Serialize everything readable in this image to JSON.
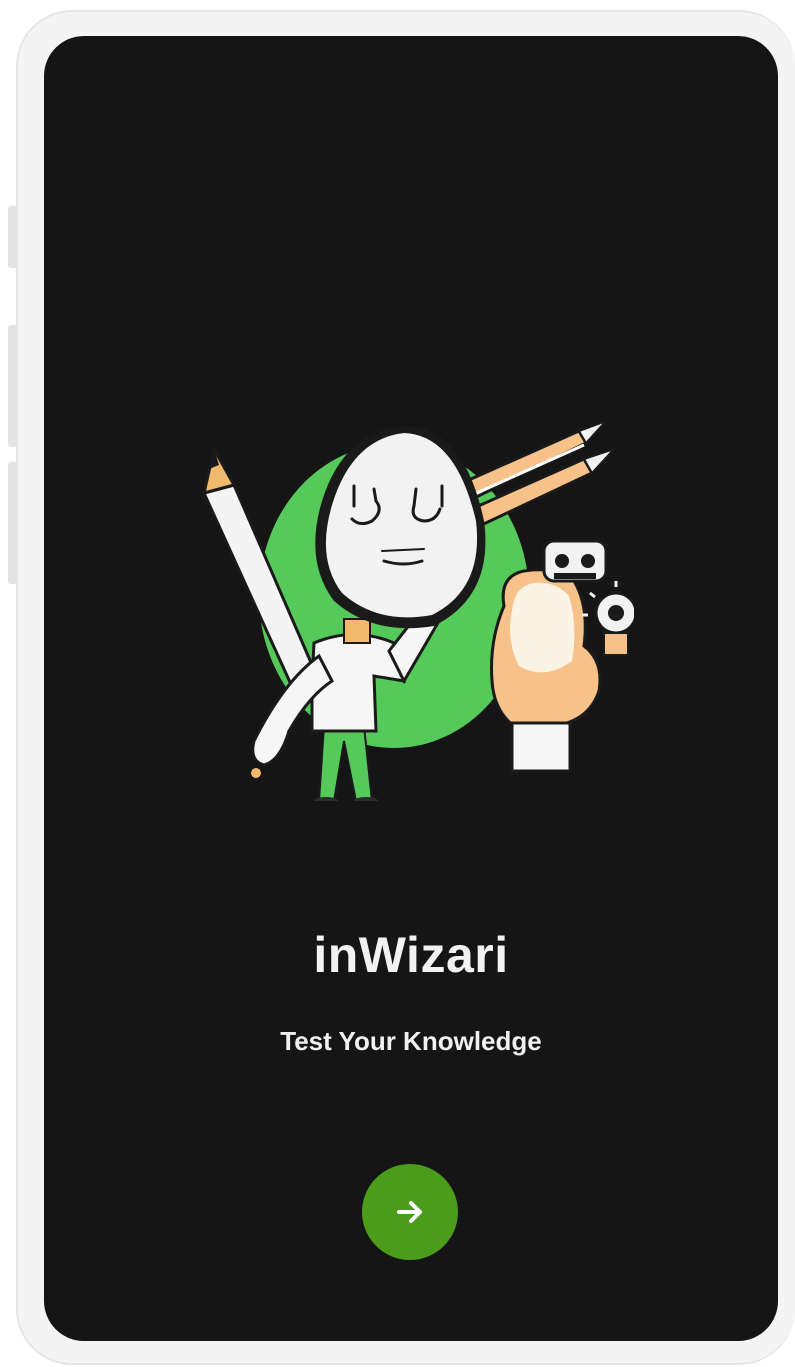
{
  "app": {
    "title": "inWizari",
    "tagline": "Test Your Knowledge"
  },
  "illustration": {
    "name": "quiz-student-illustration"
  },
  "next_button": {
    "icon": "arrow-right-icon"
  },
  "colors": {
    "screen_background": "#151515",
    "accent_green": "#4a9c1a",
    "illustration_green": "#55c95a",
    "text": "#f2f2f2"
  }
}
